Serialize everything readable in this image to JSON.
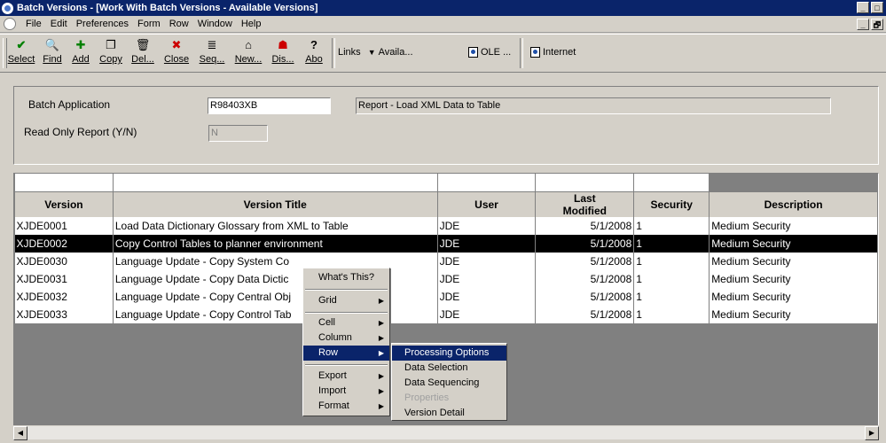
{
  "window": {
    "title": "Batch Versions - [Work With Batch Versions - Available Versions]",
    "controls": [
      "_",
      "□",
      "×"
    ]
  },
  "menubar": {
    "items": [
      "File",
      "Edit",
      "Preferences",
      "Form",
      "Row",
      "Window",
      "Help"
    ],
    "mdi_controls": [
      "_",
      "🗗"
    ]
  },
  "toolbar": {
    "buttons": [
      {
        "label": "Select",
        "icon": "checkmark-icon",
        "glyph": "✔",
        "color": "#008000"
      },
      {
        "label": "Find",
        "icon": "find-icon",
        "glyph": "🔍",
        "color": "#000000"
      },
      {
        "label": "Add",
        "icon": "add-icon",
        "glyph": "✚",
        "color": "#008000"
      },
      {
        "label": "Copy",
        "icon": "copy-icon",
        "glyph": "❐",
        "color": "#000000"
      },
      {
        "label": "Del...",
        "icon": "trash-icon",
        "glyph": "🗑",
        "color": "#000000"
      },
      {
        "label": "Close",
        "icon": "close-icon",
        "glyph": "✖",
        "color": "#cc0000"
      },
      {
        "label": "Seq...",
        "icon": "sequence-icon",
        "glyph": "≣",
        "color": "#000000"
      },
      {
        "label": "New...",
        "icon": "new-icon",
        "glyph": "⌂",
        "color": "#000000"
      },
      {
        "label": "Dis...",
        "icon": "display-icon",
        "glyph": "☗",
        "color": "#cc0000"
      },
      {
        "label": "Abo",
        "icon": "about-icon",
        "glyph": "?",
        "color": "#000000"
      }
    ],
    "links_label": "Links",
    "availa_label": "Availa...",
    "ole_label": "OLE ...",
    "internet_label": "Internet"
  },
  "header": {
    "batch_app_label": "Batch Application",
    "batch_app_value": "R98403XB",
    "batch_app_desc": "Report - Load XML Data to Table",
    "read_only_label": "Read Only Report (Y/N)",
    "read_only_value": "N"
  },
  "grid": {
    "columns": [
      "Version",
      "Version Title",
      "User",
      "Last Modified",
      "Security",
      "Description"
    ],
    "rows": [
      [
        "XJDE0001",
        "Load Data Dictionary Glossary from XML to Table",
        "JDE",
        "5/1/2008",
        "1",
        "Medium Security"
      ],
      [
        "XJDE0002",
        "Copy Control Tables to planner environment",
        "JDE",
        "5/1/2008",
        "1",
        "Medium Security"
      ],
      [
        "XJDE0030",
        "Language Update - Copy System Co",
        "JDE",
        "5/1/2008",
        "1",
        "Medium Security"
      ],
      [
        "XJDE0031",
        "Language Update - Copy Data Dictic",
        "JDE",
        "5/1/2008",
        "1",
        "Medium Security"
      ],
      [
        "XJDE0032",
        "Language Update - Copy Central Obj",
        "JDE",
        "5/1/2008",
        "1",
        "Medium Security"
      ],
      [
        "XJDE0033",
        "Language Update - Copy Control Tab",
        "JDE",
        "5/1/2008",
        "1",
        "Medium Security"
      ]
    ],
    "selected_row": 1
  },
  "context_menu": {
    "items": [
      "What's This?",
      "Grid",
      "Cell",
      "Column",
      "Row",
      "Export",
      "Import",
      "Format"
    ],
    "active": "Row"
  },
  "row_submenu": {
    "items": [
      "Processing Options",
      "Data Selection",
      "Data Sequencing",
      "Properties",
      "Version Detail"
    ],
    "active": "Processing Options",
    "disabled": [
      "Properties"
    ]
  },
  "colors": {
    "titlebar": "#0a246a",
    "selection": "#000000",
    "menu_highlight": "#0a246a",
    "face": "#d4d0c8"
  }
}
